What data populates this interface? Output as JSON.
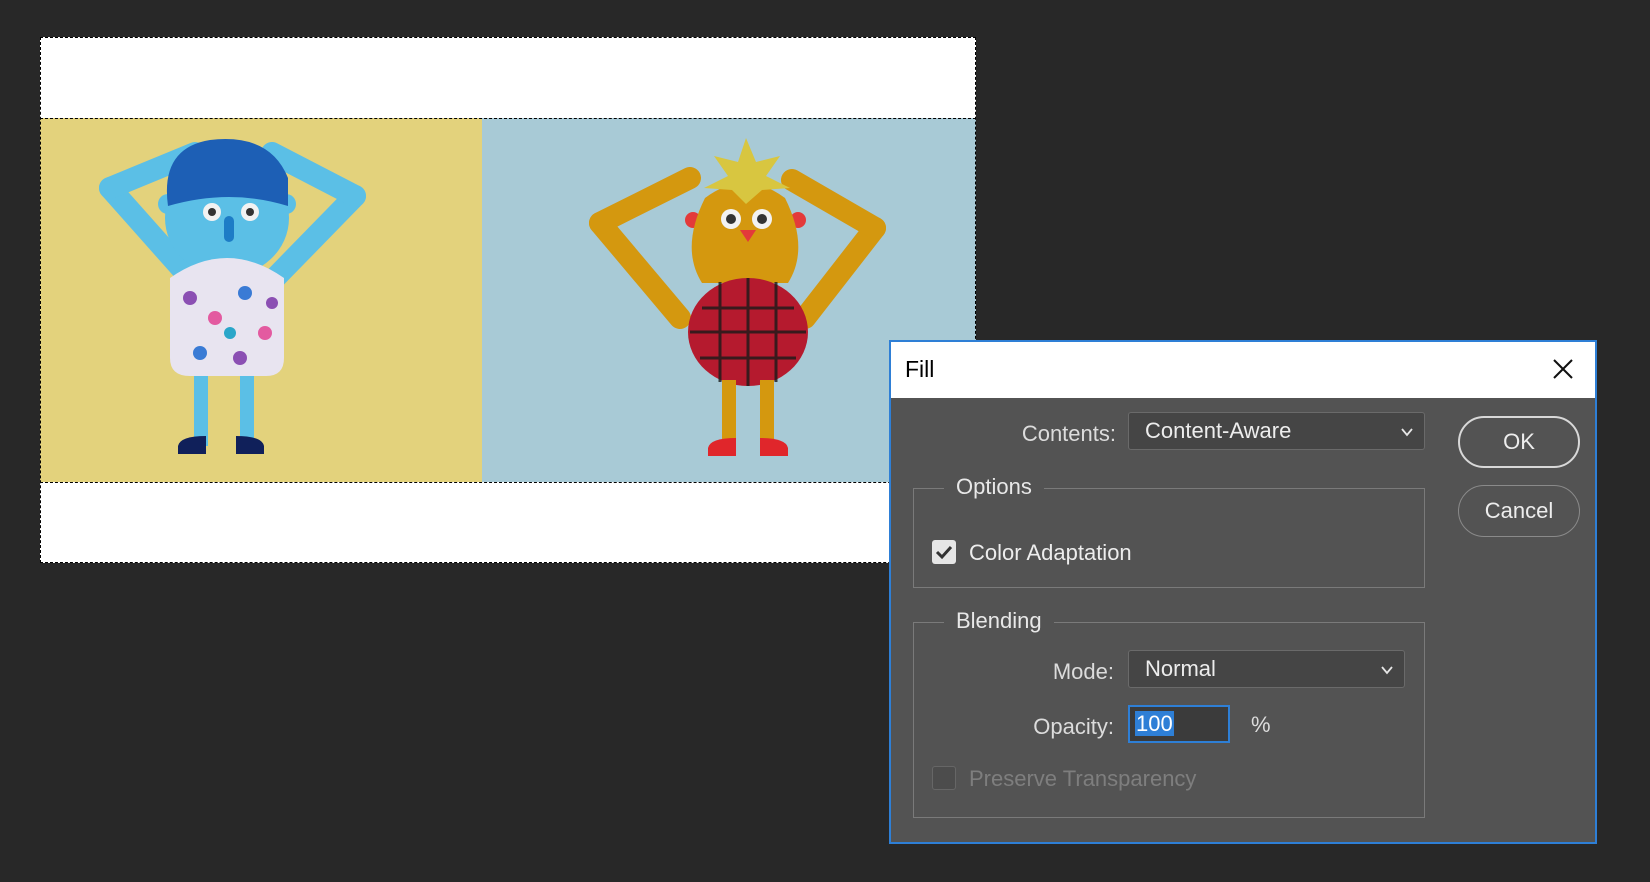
{
  "dialog": {
    "title": "Fill",
    "contents_label": "Contents:",
    "contents_value": "Content-Aware",
    "ok_label": "OK",
    "cancel_label": "Cancel",
    "options": {
      "legend": "Options",
      "color_adaptation_label": "Color Adaptation",
      "color_adaptation_checked": true
    },
    "blending": {
      "legend": "Blending",
      "mode_label": "Mode:",
      "mode_value": "Normal",
      "opacity_label": "Opacity:",
      "opacity_value": "100",
      "opacity_unit": "%",
      "preserve_transparency_label": "Preserve Transparency",
      "preserve_transparency_checked": false,
      "preserve_transparency_enabled": false
    }
  },
  "icons": {
    "close": "close-icon",
    "checkmark": "checkmark-icon",
    "dropdown": "chevron-down-icon"
  },
  "colors": {
    "workspace": "#282828",
    "dialog_bg": "#535353",
    "accent": "#2e7fd6",
    "left_photo_bg": "#e3d27c",
    "right_photo_bg": "#a8cad6"
  }
}
